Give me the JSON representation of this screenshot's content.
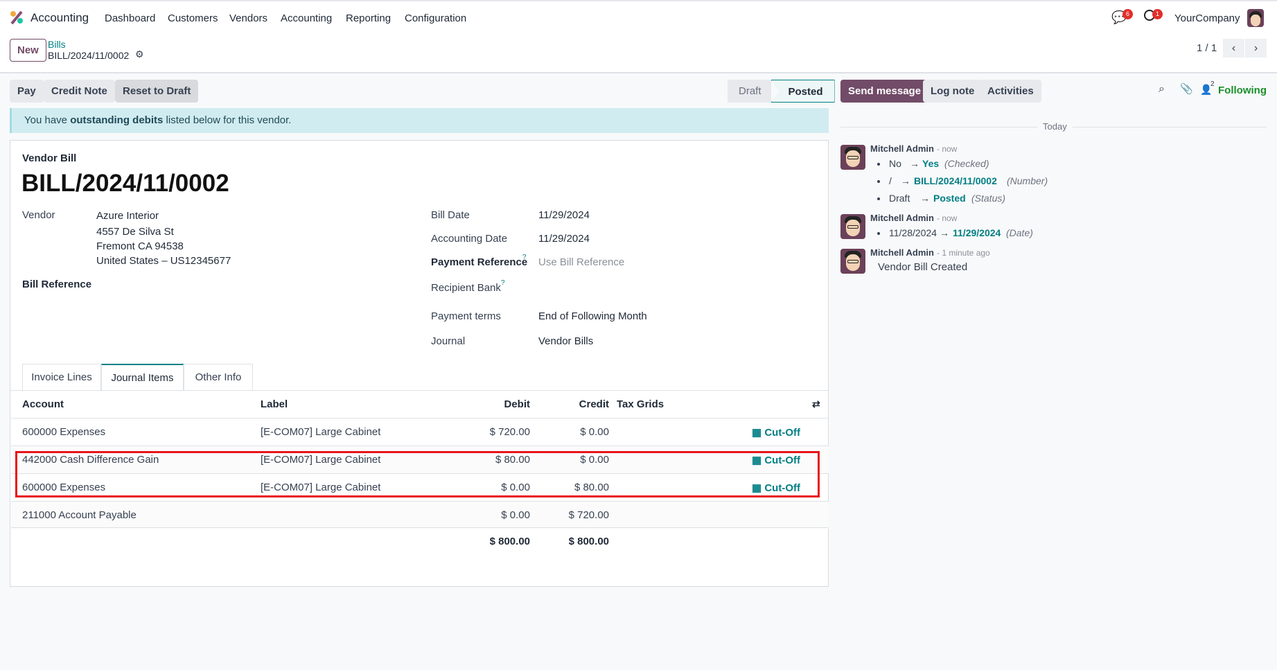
{
  "app": {
    "name": "Accounting",
    "menu": [
      "Dashboard",
      "Customers",
      "Vendors",
      "Accounting",
      "Reporting",
      "Configuration"
    ],
    "messages_count": "6",
    "activities_count": "1",
    "company": "YourCompany"
  },
  "control": {
    "new_label": "New",
    "breadcrumb_parent": "Bills",
    "breadcrumb_current": "BILL/2024/11/0002",
    "pager": "1 / 1"
  },
  "actions": {
    "pay": "Pay",
    "credit_note": "Credit Note",
    "reset": "Reset to Draft"
  },
  "status": {
    "steps": [
      "Draft",
      "Posted"
    ],
    "active": "Posted"
  },
  "alert": {
    "pre": "You have ",
    "bold": "outstanding debits",
    "post": " listed below for this vendor."
  },
  "form": {
    "type": "Vendor Bill",
    "title": "BILL/2024/11/0002",
    "vendor_label": "Vendor",
    "vendor": "Azure Interior",
    "address": [
      "4557 De Silva St",
      "Fremont CA 94538",
      "United States – US12345677"
    ],
    "bill_ref_label": "Bill Reference",
    "bill_date_label": "Bill Date",
    "bill_date": "11/29/2024",
    "acc_date_label": "Accounting Date",
    "acc_date": "11/29/2024",
    "pay_ref_label": "Payment Reference",
    "pay_ref_placeholder": "Use Bill Reference",
    "recipient_label": "Recipient Bank",
    "terms_label": "Payment terms",
    "terms": "End of Following Month",
    "journal_label": "Journal",
    "journal": "Vendor Bills",
    "help": "?"
  },
  "tabs": [
    "Invoice Lines",
    "Journal Items",
    "Other Info"
  ],
  "table": {
    "headers": {
      "account": "Account",
      "label": "Label",
      "debit": "Debit",
      "credit": "Credit",
      "tax": "Tax Grids"
    },
    "rows": [
      {
        "account": "600000 Expenses",
        "label": "[E-COM07] Large Cabinet",
        "debit": "$ 720.00",
        "credit": "$ 0.00",
        "cutoff": "Cut-Off"
      },
      {
        "account": "442000 Cash Difference Gain",
        "label": "[E-COM07] Large Cabinet",
        "debit": "$ 80.00",
        "credit": "$ 0.00",
        "cutoff": "Cut-Off"
      },
      {
        "account": "600000 Expenses",
        "label": "[E-COM07] Large Cabinet",
        "debit": "$ 0.00",
        "credit": "$ 80.00",
        "cutoff": "Cut-Off"
      },
      {
        "account": "211000 Account Payable",
        "label": "",
        "debit": "$ 0.00",
        "credit": "$ 720.00",
        "cutoff": ""
      }
    ],
    "total_debit": "$ 800.00",
    "total_credit": "$ 800.00"
  },
  "chatter": {
    "send": "Send message",
    "log": "Log note",
    "activities": "Activities",
    "followers": "2",
    "following": "Following",
    "today": "Today",
    "msgs": [
      {
        "author": "Mitchell Admin",
        "time": "- now",
        "changes": [
          {
            "old": "No",
            "new": "Yes",
            "field": "(Checked)"
          },
          {
            "old": "/",
            "new": "BILL/2024/11/0002",
            "field": "(Number)"
          },
          {
            "old": "Draft",
            "new": "Posted",
            "field": "(Status)"
          }
        ]
      },
      {
        "author": "Mitchell Admin",
        "time": "- now",
        "changes": [
          {
            "old": "11/28/2024",
            "new": "11/29/2024",
            "field": "(Date)"
          }
        ]
      },
      {
        "author": "Mitchell Admin",
        "time": "- 1 minute ago",
        "body": "Vendor Bill Created"
      }
    ],
    "arrow": "→"
  }
}
